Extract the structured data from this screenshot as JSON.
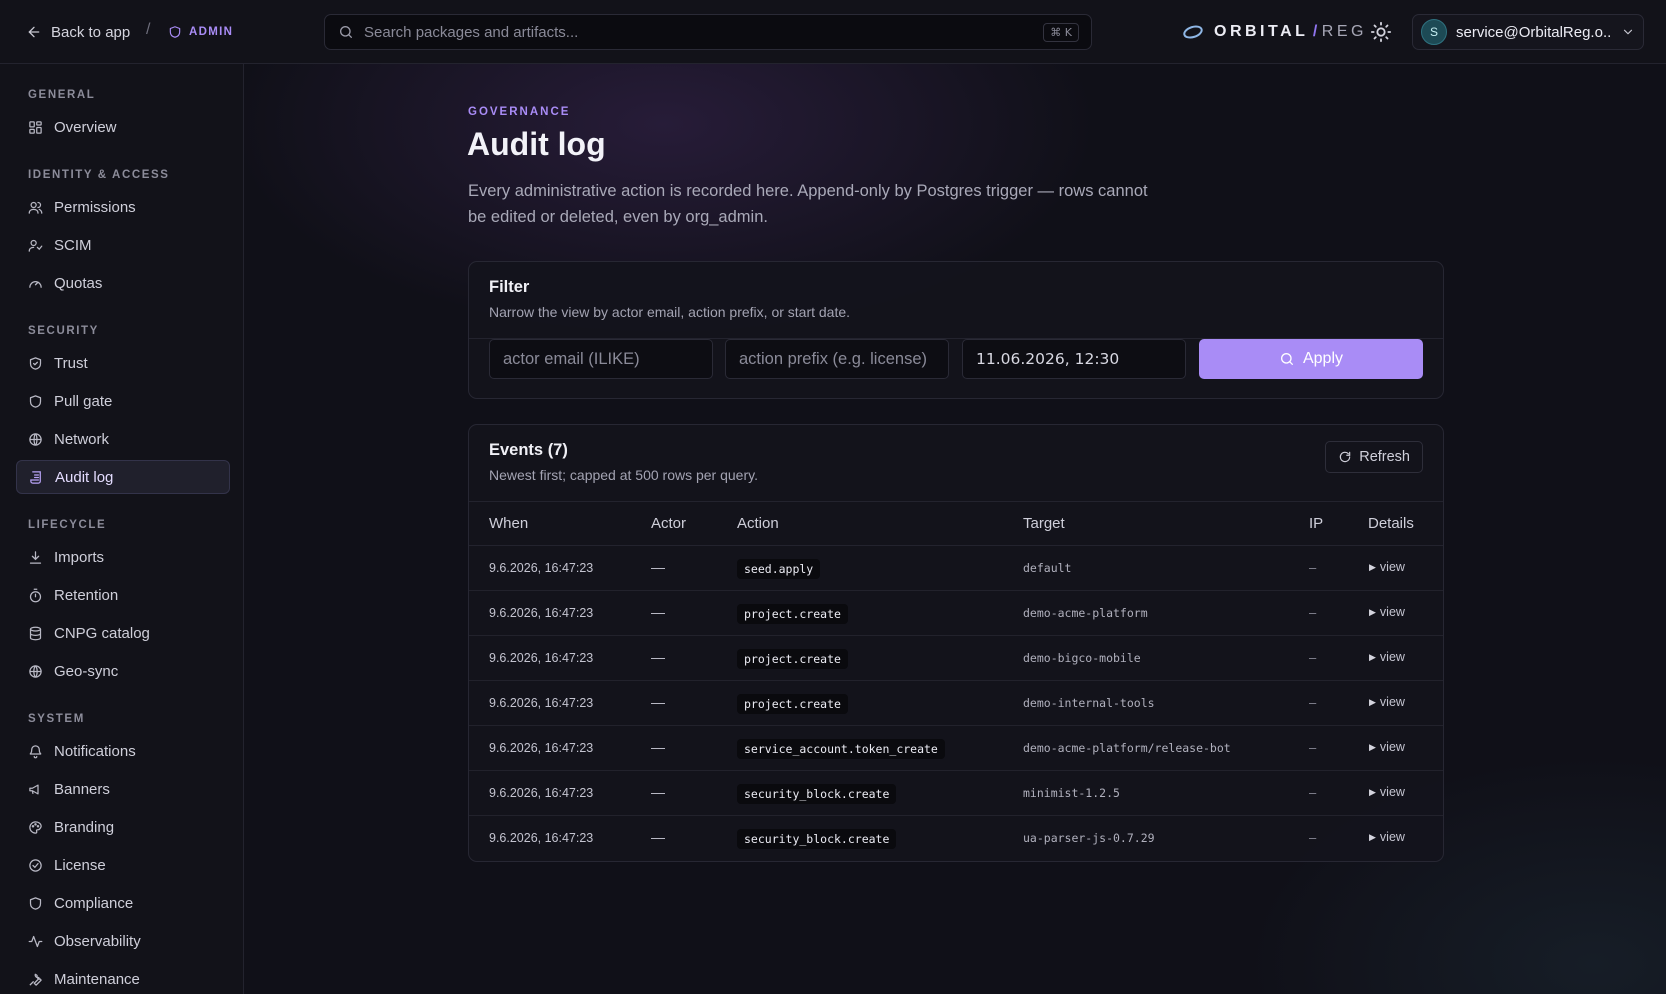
{
  "topbar": {
    "back_label": "Back to app",
    "separator": "/",
    "admin_label": "ADMIN",
    "search_placeholder": "Search packages and artifacts...",
    "search_shortcut": "⌘ K",
    "brand_name": "ORBITAL",
    "brand_slash": "/",
    "brand_sub": "REG",
    "user_initial": "S",
    "user_email": "service@OrbitalReg.o..."
  },
  "sidebar": {
    "sections": [
      {
        "title": "GENERAL",
        "items": [
          {
            "label": "Overview",
            "icon": "grid-icon"
          }
        ]
      },
      {
        "title": "IDENTITY & ACCESS",
        "items": [
          {
            "label": "Permissions",
            "icon": "users-icon"
          },
          {
            "label": "SCIM",
            "icon": "user-sync-icon"
          },
          {
            "label": "Quotas",
            "icon": "gauge-icon"
          }
        ]
      },
      {
        "title": "SECURITY",
        "items": [
          {
            "label": "Trust",
            "icon": "shield-check-icon"
          },
          {
            "label": "Pull gate",
            "icon": "shield-icon"
          },
          {
            "label": "Network",
            "icon": "network-icon"
          },
          {
            "label": "Audit log",
            "icon": "scroll-icon",
            "active": true
          }
        ]
      },
      {
        "title": "LIFECYCLE",
        "items": [
          {
            "label": "Imports",
            "icon": "download-icon"
          },
          {
            "label": "Retention",
            "icon": "timer-icon"
          },
          {
            "label": "CNPG catalog",
            "icon": "database-icon"
          },
          {
            "label": "Geo-sync",
            "icon": "globe-icon"
          }
        ]
      },
      {
        "title": "SYSTEM",
        "items": [
          {
            "label": "Notifications",
            "icon": "bell-icon"
          },
          {
            "label": "Banners",
            "icon": "megaphone-icon"
          },
          {
            "label": "Branding",
            "icon": "palette-icon"
          },
          {
            "label": "License",
            "icon": "badge-check-icon"
          },
          {
            "label": "Compliance",
            "icon": "shield-icon"
          },
          {
            "label": "Observability",
            "icon": "activity-icon"
          },
          {
            "label": "Maintenance",
            "icon": "wrench-icon"
          }
        ]
      }
    ]
  },
  "main": {
    "eyebrow": "GOVERNANCE",
    "title": "Audit log",
    "description": "Every administrative action is recorded here. Append-only by Postgres trigger — rows cannot be edited or deleted, even by org_admin."
  },
  "filter": {
    "title": "Filter",
    "subtitle": "Narrow the view by actor email, action prefix, or start date.",
    "actor_placeholder": "actor email (ILIKE)",
    "action_placeholder": "action prefix (e.g. license)",
    "date_value": "11.06.2026, 12:30",
    "apply_label": "Apply"
  },
  "events": {
    "title": "Events (7)",
    "subtitle": "Newest first; capped at 500 rows per query.",
    "refresh_label": "Refresh",
    "columns": [
      "When",
      "Actor",
      "Action",
      "Target",
      "IP",
      "Details"
    ],
    "rows": [
      {
        "when": "9.6.2026, 16:47:23",
        "actor": "—",
        "action": "seed.apply",
        "target": "default",
        "ip": "–",
        "details": "view"
      },
      {
        "when": "9.6.2026, 16:47:23",
        "actor": "—",
        "action": "project.create",
        "target": "demo-acme-platform",
        "ip": "–",
        "details": "view"
      },
      {
        "when": "9.6.2026, 16:47:23",
        "actor": "—",
        "action": "project.create",
        "target": "demo-bigco-mobile",
        "ip": "–",
        "details": "view"
      },
      {
        "when": "9.6.2026, 16:47:23",
        "actor": "—",
        "action": "project.create",
        "target": "demo-internal-tools",
        "ip": "–",
        "details": "view"
      },
      {
        "when": "9.6.2026, 16:47:23",
        "actor": "—",
        "action": "service_account.token_create",
        "target": "demo-acme-platform/release-bot",
        "ip": "–",
        "details": "view"
      },
      {
        "when": "9.6.2026, 16:47:23",
        "actor": "—",
        "action": "security_block.create",
        "target": "minimist-1.2.5",
        "ip": "–",
        "details": "view"
      },
      {
        "when": "9.6.2026, 16:47:23",
        "actor": "—",
        "action": "security_block.create",
        "target": "ua-parser-js-0.7.29",
        "ip": "–",
        "details": "view"
      }
    ]
  },
  "colors": {
    "accent": "#a98cf6",
    "background": "#101018",
    "card": "#14141c",
    "border": "#272733"
  }
}
